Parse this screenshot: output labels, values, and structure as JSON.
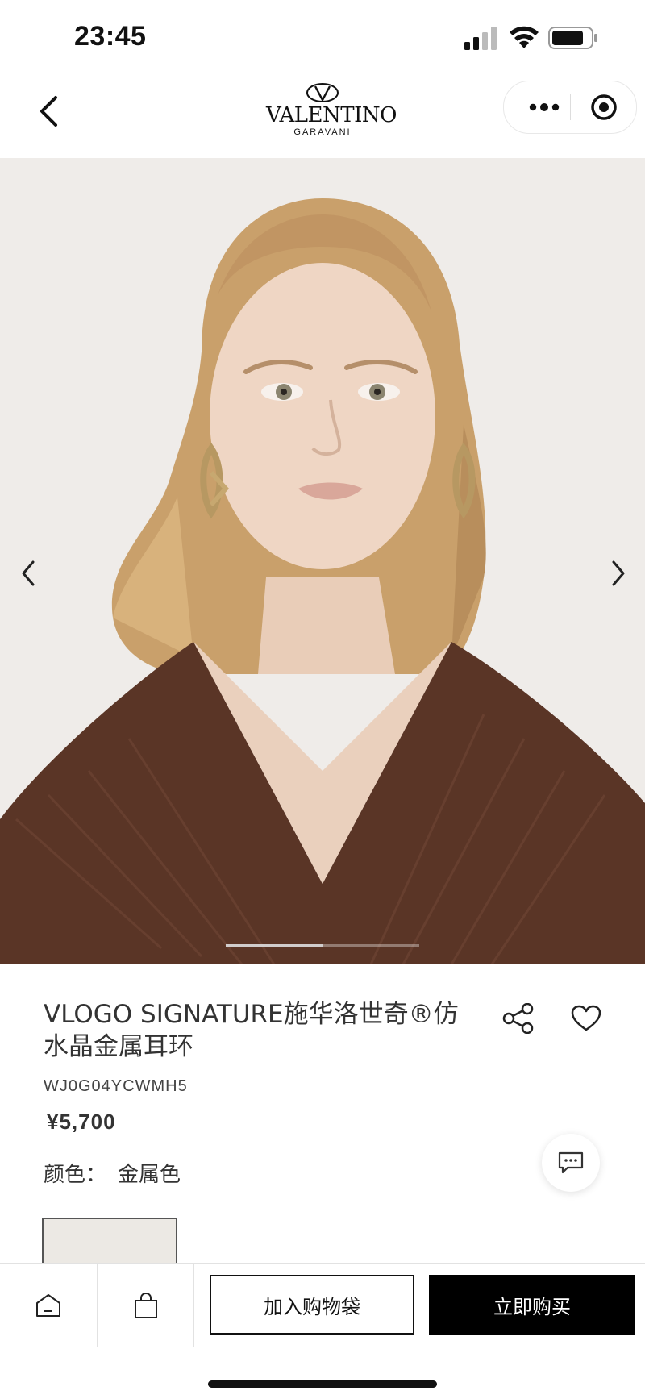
{
  "status_bar": {
    "time": "23:45",
    "icons": [
      "signal-icon",
      "wifi-icon",
      "battery-icon"
    ]
  },
  "nav": {
    "back_icon": "chevron-left-icon",
    "brand": {
      "main": "VALENTINO",
      "sub": "GARAVANI"
    },
    "capsule": {
      "more_icon": "more-dots-icon",
      "close_icon": "target-icon"
    }
  },
  "gallery": {
    "prev_icon": "chevron-left-icon",
    "next_icon": "chevron-right-icon",
    "progress": 0.5
  },
  "product": {
    "title": "VLOGO SIGNATURE施华洛世奇®仿水晶金属耳环",
    "sku": "WJ0G04YCWMH5",
    "price": "¥5,700",
    "color_label": "颜色：",
    "color_value": "金属色",
    "share_icon": "share-icon",
    "favorite_icon": "heart-icon",
    "chat_icon": "chat-bubble-icon"
  },
  "bottom_bar": {
    "home_icon": "home-icon",
    "bag_icon": "shopping-bag-icon",
    "add_to_cart": "加入购物袋",
    "buy_now": "立即购买"
  },
  "colors": {
    "background": "#ffffff",
    "photo_background": "#efece9",
    "buy_button": "#000000",
    "text": "#333333"
  }
}
